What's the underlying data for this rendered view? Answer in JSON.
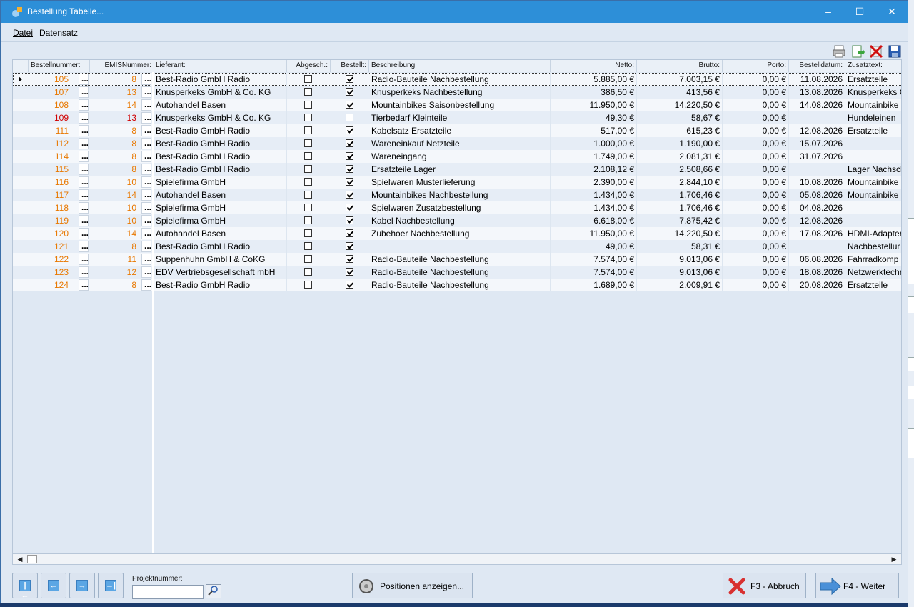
{
  "window": {
    "title": "Bestellung Tabelle..."
  },
  "menu": [
    "Datei",
    "Datensatz"
  ],
  "columns": [
    "Bestellnummer:",
    "EMISNummer:",
    "Lieferant:",
    "Abgesch.:",
    "Bestellt:",
    "Beschreibung:",
    "Netto:",
    "Brutto:",
    "Porto:",
    "Bestelldatum:",
    "Zusatztext:"
  ],
  "rows": [
    {
      "nr": "105",
      "emis": "8",
      "lieferant": "Best-Radio GmbH Radio",
      "abg": false,
      "best": true,
      "beschreibung": "Radio-Bauteile Nachbestellung",
      "netto": "5.885,00 €",
      "brutto": "7.003,15 €",
      "porto": "0,00 €",
      "datum": "11.08.2026",
      "zusatz": "Ersatzteile",
      "status": "orange",
      "selected": true
    },
    {
      "nr": "107",
      "emis": "13",
      "lieferant": "Knusperkeks GmbH & Co. KG",
      "abg": false,
      "best": true,
      "beschreibung": "Knusperkeks Nachbestellung",
      "netto": "386,50 €",
      "brutto": "413,56 €",
      "porto": "0,00 €",
      "datum": "13.08.2026",
      "zusatz": "Knusperkeks C",
      "status": "orange"
    },
    {
      "nr": "108",
      "emis": "14",
      "lieferant": "Autohandel Basen",
      "abg": false,
      "best": true,
      "beschreibung": "Mountainbikes Saisonbestellung",
      "netto": "11.950,00 €",
      "brutto": "14.220,50 €",
      "porto": "0,00 €",
      "datum": "14.08.2026",
      "zusatz": "Mountainbike",
      "status": "orange"
    },
    {
      "nr": "109",
      "emis": "13",
      "lieferant": "Knusperkeks GmbH & Co. KG",
      "abg": false,
      "best": false,
      "beschreibung": "Tierbedarf Kleinteile",
      "netto": "49,30 €",
      "brutto": "58,67 €",
      "porto": "0,00 €",
      "datum": "",
      "zusatz": "Hundeleinen",
      "status": "red"
    },
    {
      "nr": "111",
      "emis": "8",
      "lieferant": "Best-Radio GmbH Radio",
      "abg": false,
      "best": true,
      "beschreibung": "Kabelsatz Ersatzteile",
      "netto": "517,00 €",
      "brutto": "615,23 €",
      "porto": "0,00 €",
      "datum": "12.08.2026",
      "zusatz": "Ersatzteile",
      "status": "orange"
    },
    {
      "nr": "112",
      "emis": "8",
      "lieferant": "Best-Radio GmbH Radio",
      "abg": false,
      "best": true,
      "beschreibung": "Wareneinkauf Netzteile",
      "netto": "1.000,00 €",
      "brutto": "1.190,00 €",
      "porto": "0,00 €",
      "datum": "15.07.2026",
      "zusatz": "",
      "status": "orange"
    },
    {
      "nr": "114",
      "emis": "8",
      "lieferant": "Best-Radio GmbH Radio",
      "abg": false,
      "best": true,
      "beschreibung": "Wareneingang",
      "netto": "1.749,00 €",
      "brutto": "2.081,31 €",
      "porto": "0,00 €",
      "datum": "31.07.2026",
      "zusatz": "",
      "status": "orange"
    },
    {
      "nr": "115",
      "emis": "8",
      "lieferant": "Best-Radio GmbH Radio",
      "abg": false,
      "best": true,
      "beschreibung": "Ersatzteile Lager",
      "netto": "2.108,12 €",
      "brutto": "2.508,66 €",
      "porto": "0,00 €",
      "datum": "",
      "zusatz": "Lager Nachsch",
      "status": "orange"
    },
    {
      "nr": "116",
      "emis": "10",
      "lieferant": "Spielefirma GmbH",
      "abg": false,
      "best": true,
      "beschreibung": "Spielwaren Musterlieferung",
      "netto": "2.390,00 €",
      "brutto": "2.844,10 €",
      "porto": "0,00 €",
      "datum": "10.08.2026",
      "zusatz": "Mountainbike",
      "status": "orange"
    },
    {
      "nr": "117",
      "emis": "14",
      "lieferant": "Autohandel Basen",
      "abg": false,
      "best": true,
      "beschreibung": "Mountainbikes Nachbestellung",
      "netto": "1.434,00 €",
      "brutto": "1.706,46 €",
      "porto": "0,00 €",
      "datum": "05.08.2026",
      "zusatz": "Mountainbike",
      "status": "orange"
    },
    {
      "nr": "118",
      "emis": "10",
      "lieferant": "Spielefirma GmbH",
      "abg": false,
      "best": true,
      "beschreibung": "Spielwaren Zusatzbestellung",
      "netto": "1.434,00 €",
      "brutto": "1.706,46 €",
      "porto": "0,00 €",
      "datum": "04.08.2026",
      "zusatz": "",
      "status": "orange"
    },
    {
      "nr": "119",
      "emis": "10",
      "lieferant": "Spielefirma GmbH",
      "abg": false,
      "best": true,
      "beschreibung": "Kabel Nachbestellung",
      "netto": "6.618,00 €",
      "brutto": "7.875,42 €",
      "porto": "0,00 €",
      "datum": "12.08.2026",
      "zusatz": "",
      "status": "orange"
    },
    {
      "nr": "120",
      "emis": "14",
      "lieferant": "Autohandel Basen",
      "abg": false,
      "best": true,
      "beschreibung": "Zubehoer Nachbestellung",
      "netto": "11.950,00 €",
      "brutto": "14.220,50 €",
      "porto": "0,00 €",
      "datum": "17.08.2026",
      "zusatz": "HDMI-Adapter",
      "status": "orange"
    },
    {
      "nr": "121",
      "emis": "8",
      "lieferant": "Best-Radio GmbH Radio",
      "abg": false,
      "best": true,
      "beschreibung": "",
      "netto": "49,00 €",
      "brutto": "58,31 €",
      "porto": "0,00 €",
      "datum": "",
      "zusatz": "Nachbestellur",
      "status": "orange"
    },
    {
      "nr": "122",
      "emis": "11",
      "lieferant": "Suppenhuhn GmbH & CoKG",
      "abg": false,
      "best": true,
      "beschreibung": "Radio-Bauteile Nachbestellung",
      "netto": "7.574,00 €",
      "brutto": "9.013,06 €",
      "porto": "0,00 €",
      "datum": "06.08.2026",
      "zusatz": "Fahrradkomp",
      "status": "orange"
    },
    {
      "nr": "123",
      "emis": "12",
      "lieferant": "EDV Vertriebsgesellschaft mbH",
      "abg": false,
      "best": true,
      "beschreibung": "Radio-Bauteile Nachbestellung",
      "netto": "7.574,00 €",
      "brutto": "9.013,06 €",
      "porto": "0,00 €",
      "datum": "18.08.2026",
      "zusatz": "Netzwerktechr",
      "status": "orange"
    },
    {
      "nr": "124",
      "emis": "8",
      "lieferant": "Best-Radio GmbH Radio",
      "abg": false,
      "best": true,
      "beschreibung": "Radio-Bauteile Nachbestellung",
      "netto": "1.689,00 €",
      "brutto": "2.009,91 €",
      "porto": "0,00 €",
      "datum": "20.08.2026",
      "zusatz": "Ersatzteile",
      "status": "orange"
    }
  ],
  "dots_label": "...",
  "footer": {
    "projekt_label": "Projektnummer:",
    "projekt_value": "",
    "positionen_button": "Positionen anzeigen...",
    "abbruch_button": "F3 - Abbruch",
    "weiter_button": "F4 - Weiter"
  },
  "colors": {
    "orange": "#e87800",
    "red": "#d00000",
    "titlebar": "#2d8fd8"
  }
}
